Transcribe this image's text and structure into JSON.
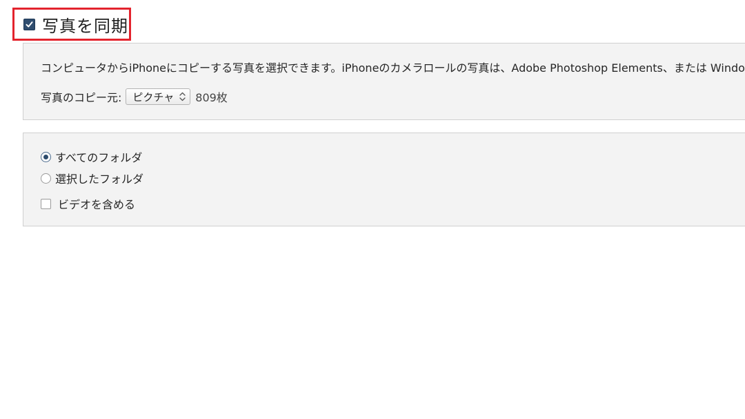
{
  "sync": {
    "checked": true,
    "title": "写真を同期",
    "highlight_color": "#e3232d"
  },
  "top_panel": {
    "description": "コンピュータからiPhoneにコピーする写真を選択できます。iPhoneのカメラロールの写真は、Adobe Photoshop Elements、または Windowsの“画像とビデオのインポート”",
    "source_label": "写真のコピー元:",
    "source_selected": "ピクチャ",
    "photo_count": "809枚"
  },
  "bottom_panel": {
    "options": [
      {
        "label": "すべてのフォルダ",
        "type": "radio",
        "checked": true
      },
      {
        "label": "選択したフォルダ",
        "type": "radio",
        "checked": false
      },
      {
        "label": "ビデオを含める",
        "type": "checkbox",
        "checked": false
      }
    ]
  },
  "icons": {
    "sync_checkbox": "checkmark-icon",
    "select_arrows": "updown-arrows-icon"
  },
  "colors": {
    "panel_bg": "#f3f3f3",
    "checkbox_fill": "#2f4d6f"
  }
}
